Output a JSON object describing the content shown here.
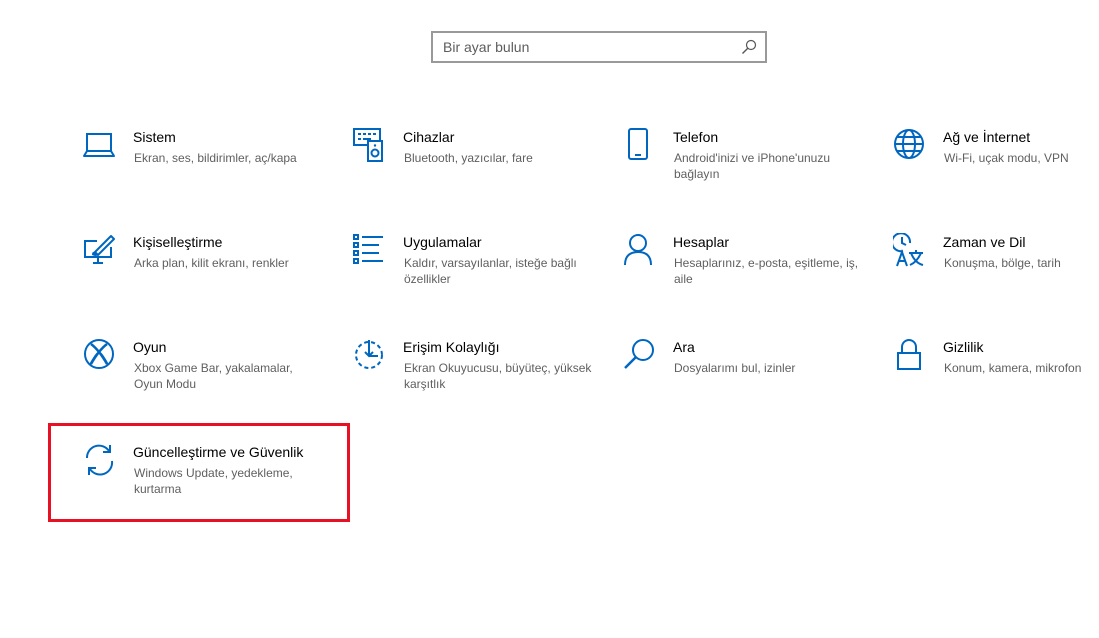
{
  "search": {
    "placeholder": "Bir ayar bulun"
  },
  "accent_color": "#0067c0",
  "highlight_color": "#e81123",
  "tiles": [
    {
      "title": "Sistem",
      "desc": "Ekran, ses, bildirimler, aç/kapa",
      "icon": "laptop-icon"
    },
    {
      "title": "Cihazlar",
      "desc": "Bluetooth, yazıcılar, fare",
      "icon": "devices-icon"
    },
    {
      "title": "Telefon",
      "desc": "Android'inizi ve iPhone'unuzu bağlayın",
      "icon": "phone-icon"
    },
    {
      "title": "Ağ ve İnternet",
      "desc": "Wi-Fi, uçak modu, VPN",
      "icon": "globe-icon"
    },
    {
      "title": "Kişiselleştirme",
      "desc": "Arka plan, kilit ekranı, renkler",
      "icon": "personalization-icon"
    },
    {
      "title": "Uygulamalar",
      "desc": "Kaldır, varsayılanlar, isteğe bağlı özellikler",
      "icon": "apps-list-icon"
    },
    {
      "title": "Hesaplar",
      "desc": "Hesaplarınız, e-posta, eşitleme, iş, aile",
      "icon": "person-icon"
    },
    {
      "title": "Zaman ve Dil",
      "desc": "Konuşma, bölge, tarih",
      "icon": "time-language-icon"
    },
    {
      "title": "Oyun",
      "desc": "Xbox Game Bar, yakalamalar, Oyun Modu",
      "icon": "xbox-icon"
    },
    {
      "title": "Erişim Kolaylığı",
      "desc": "Ekran Okuyucusu, büyüteç, yüksek karşıtlık",
      "icon": "ease-of-access-icon"
    },
    {
      "title": "Ara",
      "desc": "Dosyalarımı bul, izinler",
      "icon": "search-magnifier-icon"
    },
    {
      "title": "Gizlilik",
      "desc": "Konum, kamera, mikrofon",
      "icon": "lock-icon"
    },
    {
      "title": "Güncelleştirme ve Güvenlik",
      "desc": "Windows Update, yedekleme, kurtarma",
      "icon": "sync-icon"
    }
  ]
}
